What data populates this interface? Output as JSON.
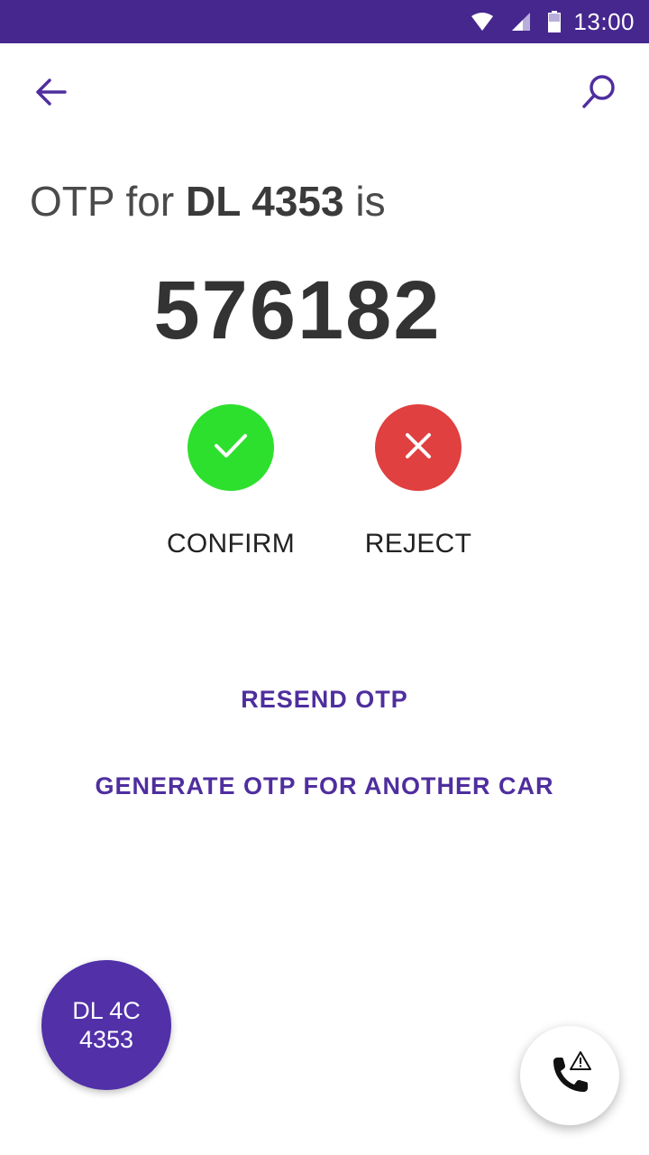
{
  "status_bar": {
    "time": "13:00",
    "icons": [
      "wifi-icon",
      "signal-icon",
      "battery-icon"
    ],
    "background": "#46278e"
  },
  "toolbar": {
    "back_icon": "arrow-left-icon",
    "search_icon": "search-icon",
    "accent": "#4f2e9e"
  },
  "otp": {
    "heading_prefix": "OTP for ",
    "plate": "DL 4353",
    "heading_suffix": " is",
    "code": "576182"
  },
  "actions": {
    "confirm_label": "CONFIRM",
    "confirm_icon": "check-icon",
    "confirm_color": "#2ee02e",
    "reject_label": "REJECT",
    "reject_icon": "close-icon",
    "reject_color": "#e04040"
  },
  "links": {
    "resend": "RESEND OTP",
    "generate": "GENERATE OTP FOR ANOTHER CAR"
  },
  "car_badge": {
    "line1": "DL 4C",
    "line2": "4353",
    "color": "#5130a8"
  },
  "call_fab": {
    "icon": "phone-alert-icon"
  }
}
